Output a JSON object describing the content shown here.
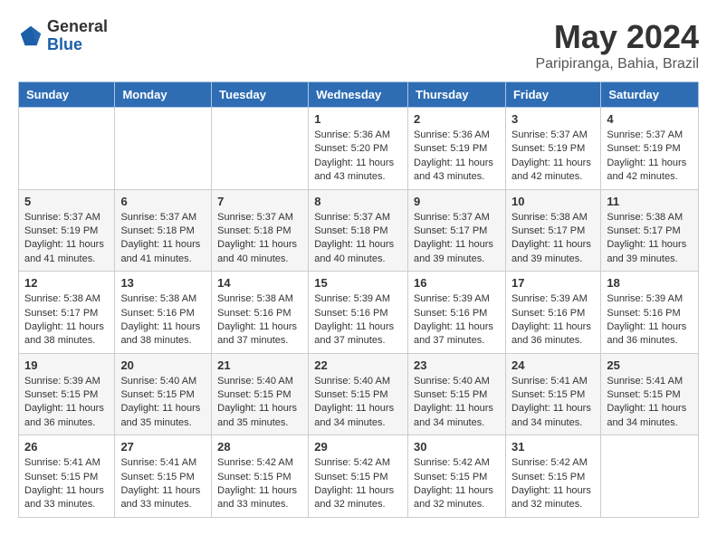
{
  "logo": {
    "general": "General",
    "blue": "Blue"
  },
  "title": "May 2024",
  "subtitle": "Paripiranga, Bahia, Brazil",
  "headers": [
    "Sunday",
    "Monday",
    "Tuesday",
    "Wednesday",
    "Thursday",
    "Friday",
    "Saturday"
  ],
  "weeks": [
    [
      {
        "day": "",
        "info": ""
      },
      {
        "day": "",
        "info": ""
      },
      {
        "day": "",
        "info": ""
      },
      {
        "day": "1",
        "info": "Sunrise: 5:36 AM\nSunset: 5:20 PM\nDaylight: 11 hours and 43 minutes."
      },
      {
        "day": "2",
        "info": "Sunrise: 5:36 AM\nSunset: 5:19 PM\nDaylight: 11 hours and 43 minutes."
      },
      {
        "day": "3",
        "info": "Sunrise: 5:37 AM\nSunset: 5:19 PM\nDaylight: 11 hours and 42 minutes."
      },
      {
        "day": "4",
        "info": "Sunrise: 5:37 AM\nSunset: 5:19 PM\nDaylight: 11 hours and 42 minutes."
      }
    ],
    [
      {
        "day": "5",
        "info": "Sunrise: 5:37 AM\nSunset: 5:19 PM\nDaylight: 11 hours and 41 minutes."
      },
      {
        "day": "6",
        "info": "Sunrise: 5:37 AM\nSunset: 5:18 PM\nDaylight: 11 hours and 41 minutes."
      },
      {
        "day": "7",
        "info": "Sunrise: 5:37 AM\nSunset: 5:18 PM\nDaylight: 11 hours and 40 minutes."
      },
      {
        "day": "8",
        "info": "Sunrise: 5:37 AM\nSunset: 5:18 PM\nDaylight: 11 hours and 40 minutes."
      },
      {
        "day": "9",
        "info": "Sunrise: 5:37 AM\nSunset: 5:17 PM\nDaylight: 11 hours and 39 minutes."
      },
      {
        "day": "10",
        "info": "Sunrise: 5:38 AM\nSunset: 5:17 PM\nDaylight: 11 hours and 39 minutes."
      },
      {
        "day": "11",
        "info": "Sunrise: 5:38 AM\nSunset: 5:17 PM\nDaylight: 11 hours and 39 minutes."
      }
    ],
    [
      {
        "day": "12",
        "info": "Sunrise: 5:38 AM\nSunset: 5:17 PM\nDaylight: 11 hours and 38 minutes."
      },
      {
        "day": "13",
        "info": "Sunrise: 5:38 AM\nSunset: 5:16 PM\nDaylight: 11 hours and 38 minutes."
      },
      {
        "day": "14",
        "info": "Sunrise: 5:38 AM\nSunset: 5:16 PM\nDaylight: 11 hours and 37 minutes."
      },
      {
        "day": "15",
        "info": "Sunrise: 5:39 AM\nSunset: 5:16 PM\nDaylight: 11 hours and 37 minutes."
      },
      {
        "day": "16",
        "info": "Sunrise: 5:39 AM\nSunset: 5:16 PM\nDaylight: 11 hours and 37 minutes."
      },
      {
        "day": "17",
        "info": "Sunrise: 5:39 AM\nSunset: 5:16 PM\nDaylight: 11 hours and 36 minutes."
      },
      {
        "day": "18",
        "info": "Sunrise: 5:39 AM\nSunset: 5:16 PM\nDaylight: 11 hours and 36 minutes."
      }
    ],
    [
      {
        "day": "19",
        "info": "Sunrise: 5:39 AM\nSunset: 5:15 PM\nDaylight: 11 hours and 36 minutes."
      },
      {
        "day": "20",
        "info": "Sunrise: 5:40 AM\nSunset: 5:15 PM\nDaylight: 11 hours and 35 minutes."
      },
      {
        "day": "21",
        "info": "Sunrise: 5:40 AM\nSunset: 5:15 PM\nDaylight: 11 hours and 35 minutes."
      },
      {
        "day": "22",
        "info": "Sunrise: 5:40 AM\nSunset: 5:15 PM\nDaylight: 11 hours and 34 minutes."
      },
      {
        "day": "23",
        "info": "Sunrise: 5:40 AM\nSunset: 5:15 PM\nDaylight: 11 hours and 34 minutes."
      },
      {
        "day": "24",
        "info": "Sunrise: 5:41 AM\nSunset: 5:15 PM\nDaylight: 11 hours and 34 minutes."
      },
      {
        "day": "25",
        "info": "Sunrise: 5:41 AM\nSunset: 5:15 PM\nDaylight: 11 hours and 34 minutes."
      }
    ],
    [
      {
        "day": "26",
        "info": "Sunrise: 5:41 AM\nSunset: 5:15 PM\nDaylight: 11 hours and 33 minutes."
      },
      {
        "day": "27",
        "info": "Sunrise: 5:41 AM\nSunset: 5:15 PM\nDaylight: 11 hours and 33 minutes."
      },
      {
        "day": "28",
        "info": "Sunrise: 5:42 AM\nSunset: 5:15 PM\nDaylight: 11 hours and 33 minutes."
      },
      {
        "day": "29",
        "info": "Sunrise: 5:42 AM\nSunset: 5:15 PM\nDaylight: 11 hours and 32 minutes."
      },
      {
        "day": "30",
        "info": "Sunrise: 5:42 AM\nSunset: 5:15 PM\nDaylight: 11 hours and 32 minutes."
      },
      {
        "day": "31",
        "info": "Sunrise: 5:42 AM\nSunset: 5:15 PM\nDaylight: 11 hours and 32 minutes."
      },
      {
        "day": "",
        "info": ""
      }
    ]
  ]
}
